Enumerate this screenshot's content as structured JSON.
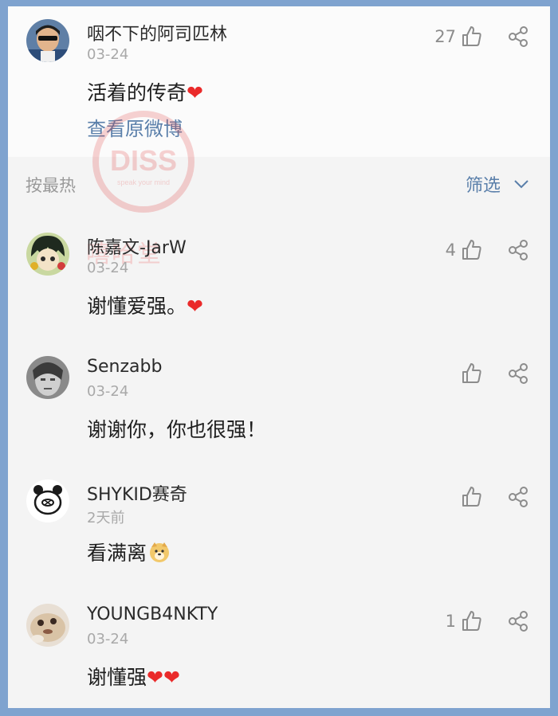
{
  "top_comment": {
    "username": "咽不下的阿司匹林",
    "date": "03-24",
    "text": "活着的传奇",
    "emoji": "❤",
    "likes": "27",
    "view_original": "查看原微博"
  },
  "sort_bar": {
    "label": "按最热",
    "filter": "筛选"
  },
  "watermark": {
    "badge": "DISS",
    "tagline": "speak your mind",
    "text": "嘻哈堂"
  },
  "comments": [
    {
      "username": "陈嘉文-JarW",
      "date": "03-24",
      "text": "谢懂爱强。",
      "emoji": "❤",
      "likes": "4"
    },
    {
      "username": "Senzabb",
      "date": "03-24",
      "text": "谢谢你，你也很强！",
      "likes": ""
    },
    {
      "username": "SHYKID赛奇",
      "date": "2天前",
      "text": "看满离",
      "likes": ""
    },
    {
      "username": "YOUNGB4NKTY",
      "date": "03-24",
      "text": "谢懂强",
      "emoji": "❤❤",
      "likes": "1"
    }
  ],
  "colors": {
    "link": "#5a7faa",
    "heart": "#ea2a2a",
    "background": "#f4f4f4"
  },
  "icons": [
    "thumbs-up-icon",
    "share-icon",
    "chevron-down-icon",
    "doge-emoji-icon"
  ]
}
